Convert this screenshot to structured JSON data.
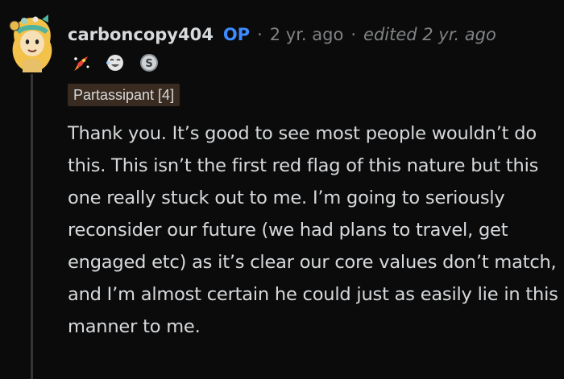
{
  "comment": {
    "username": "carboncopy404",
    "op_tag": "OP",
    "separator": "·",
    "age": "2 yr. ago",
    "edited": "edited 2 yr. ago",
    "flair": "Partassipant [4]",
    "awards": [
      "rocket-like-award-icon",
      "laughing-face-award-icon",
      "silver-award-icon"
    ],
    "body": "Thank you. It’s good to see most people wouldn’t do this. This isn’t the first red flag of this nature but this one really stuck out to me. I’m going to seriously reconsider our future (we had plans to travel, get engaged etc) as it’s clear our core values don’t match, and I’m almost certain he could just as easily lie in this manner to me."
  },
  "colors": {
    "background": "#0b0b0c",
    "text": "#d7dadc",
    "muted": "#818384",
    "op_accent": "#3d8bff",
    "flair_bg": "#3a2b20",
    "thread_line": "#343536"
  }
}
